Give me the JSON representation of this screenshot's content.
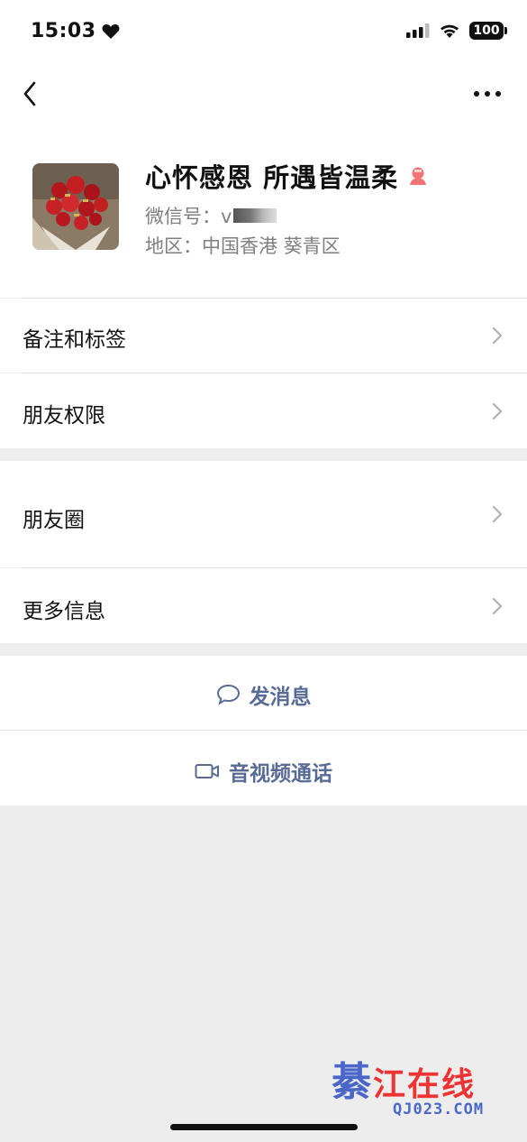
{
  "status_bar": {
    "time": "15:03",
    "battery": "100"
  },
  "profile": {
    "name": "心怀感恩  所遇皆温柔",
    "wechat_id_label": "微信号：v",
    "region": "地区：中国香港 葵青区"
  },
  "menu": {
    "notes_tags": "备注和标签",
    "friend_permissions": "朋友权限",
    "moments": "朋友圈",
    "more_info": "更多信息"
  },
  "actions": {
    "send_message": "发消息",
    "video_call": "音视频通话"
  },
  "watermark": {
    "brand_first": "綦",
    "brand_rest": "江在线",
    "domain": "QJ023.COM"
  },
  "colors": {
    "link_blue": "#576b95",
    "gray_text": "#7f7f7f",
    "background": "#ededed"
  }
}
